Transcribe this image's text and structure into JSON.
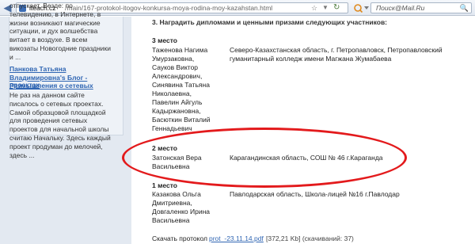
{
  "browser": {
    "url_host": "iteach.cz",
    "url_path": "/main/167-protokol-itogov-konkursa-moya-rodina-moy-kazahstan.html",
    "search_placeholder": "Поиск@Mail.Ru"
  },
  "sidebar": {
    "text1": "отпускает. Везде: по телевидению, в Интернете, в жизни возникают магические ситуации, и дух волшебства витает в воздухе. В всем викозаты Новогодние праздники и ...",
    "blog_title": "Панкова Татьяна Владимировна's Блог - Размышления о сетевых",
    "post_title": "проектах",
    "text2": "Не раз на данном сайте писалось о сетевых проектах. Самой образцовой площадкой для проведения сетевых проектов для начальной школы считаю Начальку. Здесь каждый проект продуман до мелочей, здесь ..."
  },
  "content": {
    "heading": "3. Наградить дипломами и ценными призами следующих участников:",
    "place3": {
      "label": "3 место",
      "entries": [
        {
          "name": "Таженова Нагима Умурзаковна,",
          "location": "Северо-Казахстанская область, г. Петропавловск, Петропавловский гуманитарный колледж имени Магжана Жумабаева"
        },
        {
          "name": "Сауков Виктор Александрович,",
          "location": ""
        },
        {
          "name": "Синявина Татьяна Николаевна,",
          "location": ""
        },
        {
          "name": "Павелин Айгуль Кадыржановна,",
          "location": ""
        },
        {
          "name": "Басюткин Виталий Геннадьевич",
          "location": ""
        }
      ]
    },
    "place2": {
      "label": "2 место",
      "entries": [
        {
          "name": "Затонская Вера Васильевна",
          "location": "Карагандинская область, СОШ № 46 г.Караганда"
        }
      ]
    },
    "place1": {
      "label": "1 место",
      "entries": [
        {
          "name": "Казакова Ольга Дмитриевна,",
          "location": "Павлодарская область, Школа-лицей №16 г.Павлодар"
        },
        {
          "name": "Довгаленко Ирина Васильевна",
          "location": ""
        }
      ]
    },
    "download": {
      "label": "Скачать протокол",
      "link": "prot_-23.11.14.pdf",
      "meta": "[372,21 Kb] (скачиваний: 37)"
    }
  }
}
